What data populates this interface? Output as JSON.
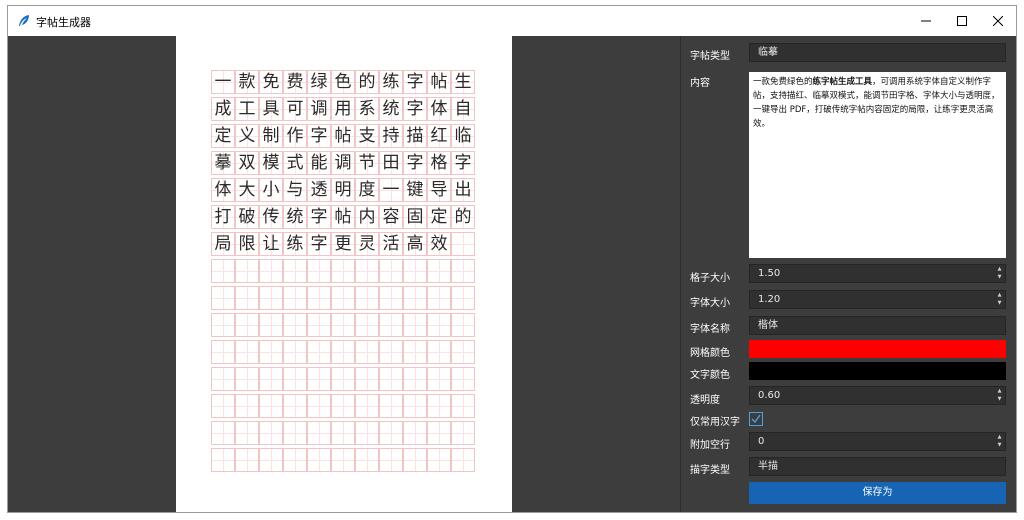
{
  "window": {
    "title": "字帖生成器",
    "minimize_icon": "minimize-icon",
    "maximize_icon": "maximize-icon",
    "close_icon": "close-icon"
  },
  "preview": {
    "rows": [
      "一款免费绿色的练字帖生",
      "成工具可调用系统字体自",
      "定义制作字帖支持描红临",
      "摹双模式能调节田字格字",
      "体大小与透明度一键导出",
      "打破传统字帖内容固定的",
      "局限让练字更灵活高效",
      "",
      "",
      "",
      "",
      "",
      "",
      "",
      ""
    ]
  },
  "settings": {
    "copybook_type": {
      "label": "字帖类型",
      "value": "临摹"
    },
    "content": {
      "label": "内容",
      "before": "一款免费绿色的",
      "bold": "练字帖生成工具",
      "after": "，可调用系统字体自定义制作字帖，支持描红、临摹双模式，能调节田字格、字体大小与透明度，一键导出 PDF，打破传统字帖内容固定的局限，让练字更灵活高效。"
    },
    "grid_size": {
      "label": "格子大小",
      "value": "1.50"
    },
    "font_size": {
      "label": "字体大小",
      "value": "1.20"
    },
    "font_name": {
      "label": "字体名称",
      "value": "楷体"
    },
    "grid_color": {
      "label": "网格颜色",
      "color": "#ff0000"
    },
    "text_color": {
      "label": "文字颜色",
      "color": "#000000"
    },
    "opacity": {
      "label": "透明度",
      "value": "0.60"
    },
    "common_only": {
      "label": "仅常用汉字",
      "checked": true
    },
    "extra_blank_lines": {
      "label": "附加空行",
      "value": "0"
    },
    "trace_type": {
      "label": "描字类型",
      "value": "半描"
    },
    "save_button": "保存为"
  }
}
